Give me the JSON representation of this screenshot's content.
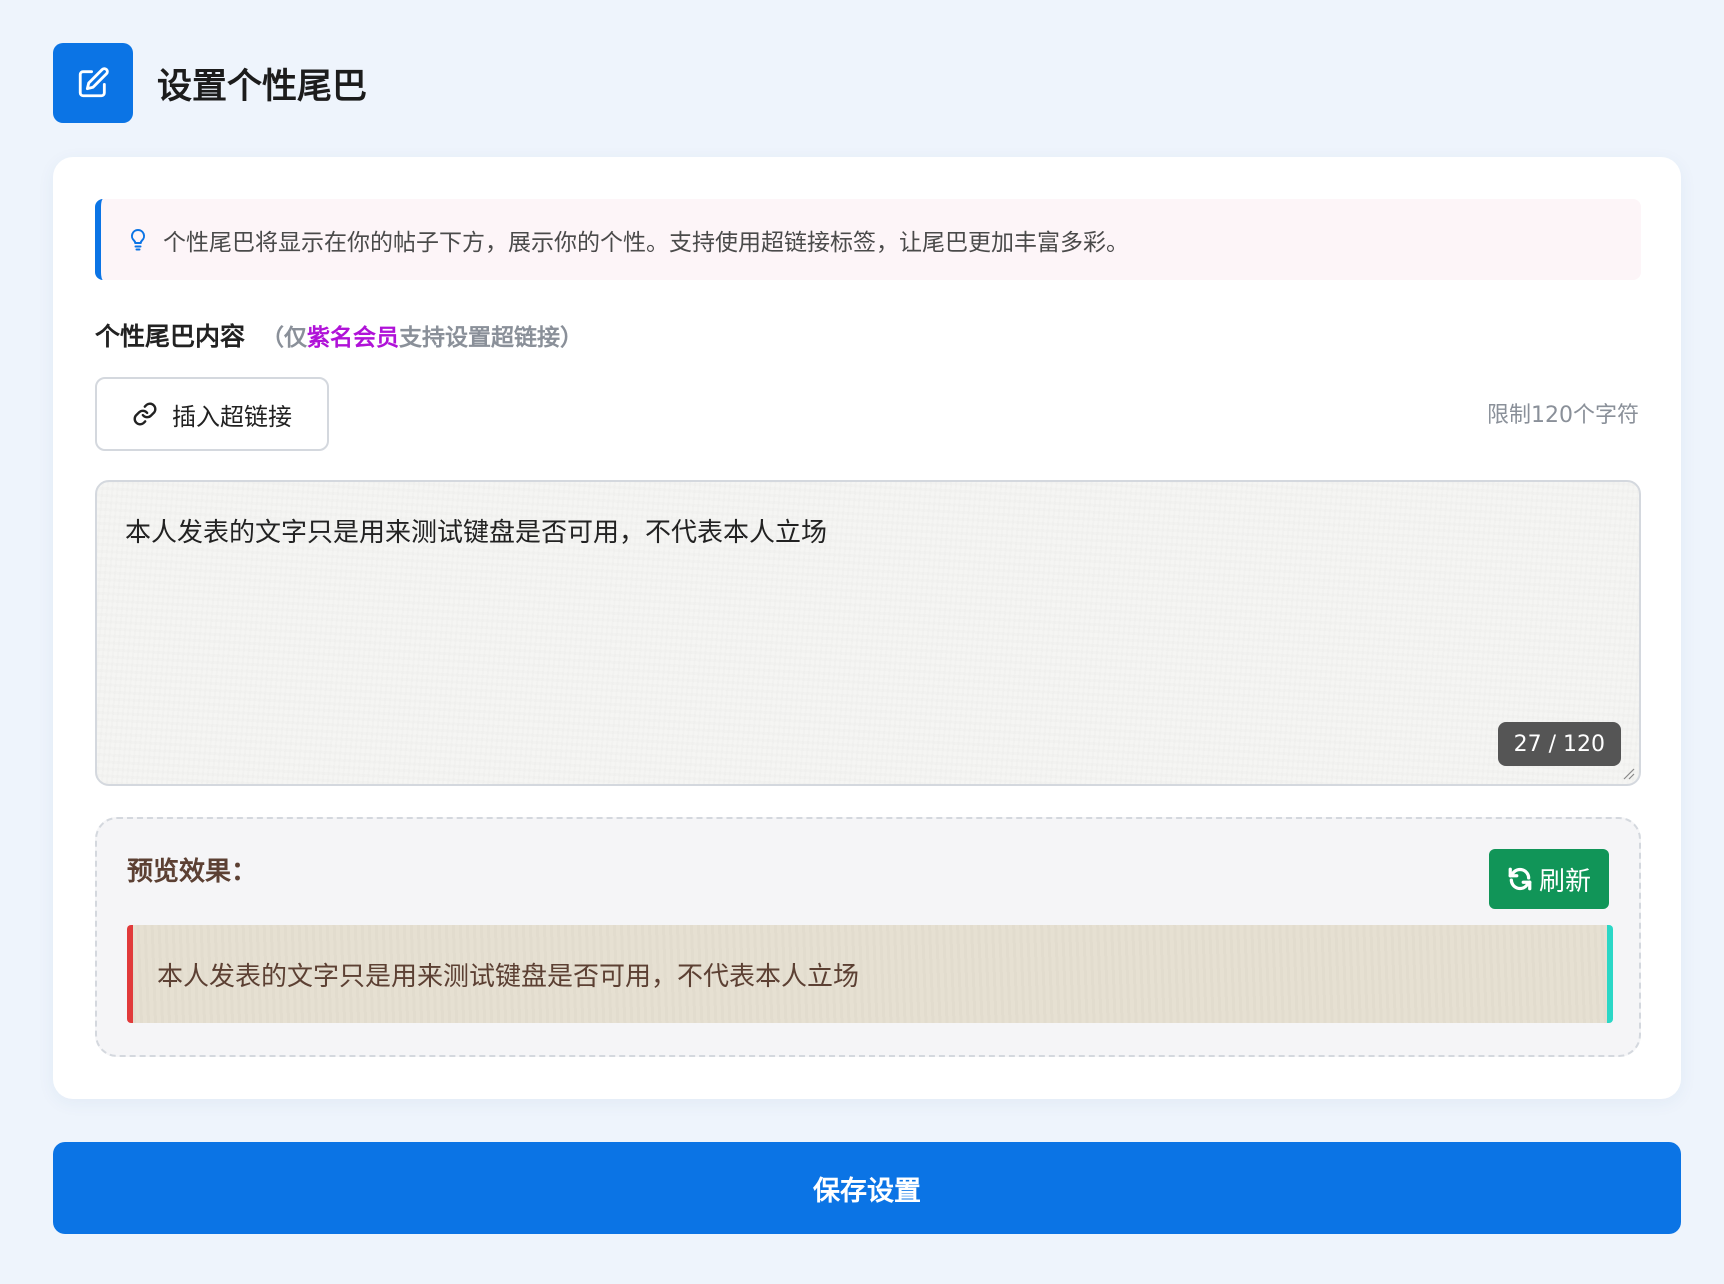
{
  "header": {
    "title": "设置个性尾巴",
    "icon": "edit-icon"
  },
  "tip": {
    "icon": "lightbulb-icon",
    "text": "个性尾巴将显示在你的帖子下方，展示你的个性。支持使用超链接标签，让尾巴更加丰富多彩。"
  },
  "content_label": {
    "main": "个性尾巴内容",
    "note_prefix": "（仅",
    "note_vip": "紫名会员",
    "note_suffix": "支持设置超链接）"
  },
  "insert_link_button": {
    "label": "插入超链接",
    "icon": "link-icon"
  },
  "limit_text": "限制120个字符",
  "editor": {
    "value": "本人发表的文字只是用来测试键盘是否可用，不代表本人立场",
    "counter": "27 / 120"
  },
  "preview": {
    "title": "预览效果：",
    "refresh_label": "刷新",
    "refresh_icon": "refresh-icon",
    "text": "本人发表的文字只是用来测试键盘是否可用，不代表本人立场"
  },
  "save_button": {
    "label": "保存设置"
  },
  "colors": {
    "primary": "#0b74e5",
    "vip_purple": "#b012d8",
    "refresh_green": "#119558",
    "preview_left_border": "#e13a3a",
    "preview_right_border": "#2bd7c6",
    "preview_text": "#5c4033"
  }
}
